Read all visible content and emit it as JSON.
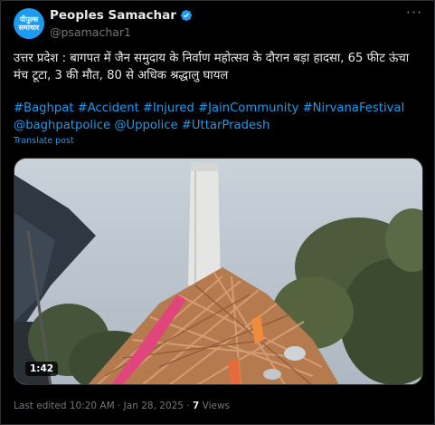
{
  "author": {
    "name": "Peoples Samachar",
    "handle": "@psamachar1",
    "avatar_text": "पीपुल्स समाचार"
  },
  "tweet": {
    "text": "उत्तर प्रदेश : बागपत में जैन समुदाय के निर्वाण महोत्सव के दौरान बड़ा हादसा, 65 फीट ऊंचा मंच टूटा, 3 की मौत, 80 से अधिक श्रद्धालु घायल",
    "hashtags": "#Baghpat #Accident #Injured #JainCommunity #NirvanaFestival @baghpatpolice @Uppolice #UttarPradesh",
    "translate_label": "Translate post"
  },
  "media": {
    "duration": "1:42"
  },
  "meta": {
    "last_edited": "Last edited 10:20 AM · Jan 28, 2025 ·",
    "views_count": "7",
    "views_label": "Views"
  },
  "colors": {
    "accent": "#1d9bf0",
    "background": "#000000",
    "muted": "#71767b",
    "text": "#e7e9ea"
  },
  "icons": {
    "verified": "verified-badge-icon",
    "more": "more-options-icon"
  }
}
